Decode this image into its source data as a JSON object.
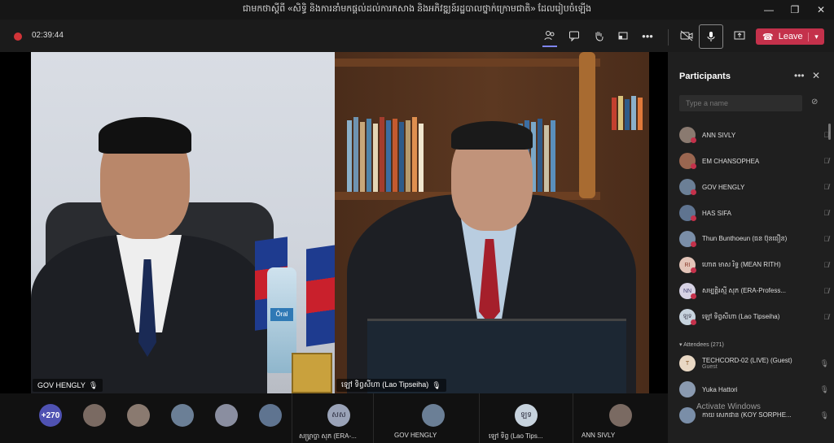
{
  "window": {
    "title": "ជាមកថាស្តីពី «សិទ្ធិ និងការនាំមកផ្តល់ដល់ការកសាង និងអភិវឌ្ឍន៍រដ្ឋបាលថ្នាក់ក្រោមជាតិ» ដែលរៀបចំឡើង",
    "min_glyph": "—",
    "restore_glyph": "❐",
    "close_glyph": "✕"
  },
  "toolbar": {
    "timer": "02:39:44",
    "leave_label": "Leave",
    "icons": [
      "participants-icon",
      "chat-icon",
      "raise-hand-icon",
      "rooms-icon",
      "more-icon",
      "camera-off-icon",
      "mic-icon",
      "share-icon"
    ]
  },
  "stage": {
    "left_name": "GOV HENGLY",
    "right_name": "ឡៅ ទិព្វសីហា (Lao Tipseiha)",
    "bottle_label": "Ôral"
  },
  "strip": {
    "overflow": "+270",
    "labels": [
      "សម្ព្រាច្ចា សុភ (ERA-...",
      "GOV HENGLY",
      "ឡៅ ទិព្វ (Lao Tips...",
      "ANN SIVLY"
    ],
    "initials": {
      "tile1": "សស",
      "tile3": "ឡទ"
    }
  },
  "panel": {
    "title": "Participants",
    "search_placeholder": "Type a name",
    "attendees_header": "Attendees (271)",
    "presenters": [
      {
        "name": "ANN SIVLY",
        "initials": ""
      },
      {
        "name": "EM CHANSOPHEA",
        "initials": ""
      },
      {
        "name": "GOV HENGLY",
        "initials": ""
      },
      {
        "name": "HAS SIFA",
        "initials": ""
      },
      {
        "name": "Thun Bunthoeun (ធន ប៊ុនធឿន)",
        "initials": ""
      },
      {
        "name": "ហោត មាស រិទ្ធ (MEAN RITH)",
        "initials": "RI"
      },
      {
        "name": "សម្បត្តិរស្មី សុភ (ERA-Profess...",
        "initials": "NN"
      },
      {
        "name": "ឡៅ ទិព្វសីហា (Lao Tipseiha)",
        "initials": "ឡទ"
      }
    ],
    "attendees": [
      {
        "name": "TECHCORD-02 (LIVE) (Guest)",
        "sub": "Guest",
        "initials": "T"
      },
      {
        "name": "Yuka Hattori",
        "sub": "",
        "initials": ""
      },
      {
        "name": "កាយ សេកផាន (KOY SORPHE...",
        "sub": "",
        "initials": ""
      }
    ]
  },
  "watermark": "Activate Windows",
  "colors": {
    "accent": "#7f85f5",
    "leave": "#c4314b",
    "busy": "#c4314b",
    "overflow": "#4f52b2"
  }
}
